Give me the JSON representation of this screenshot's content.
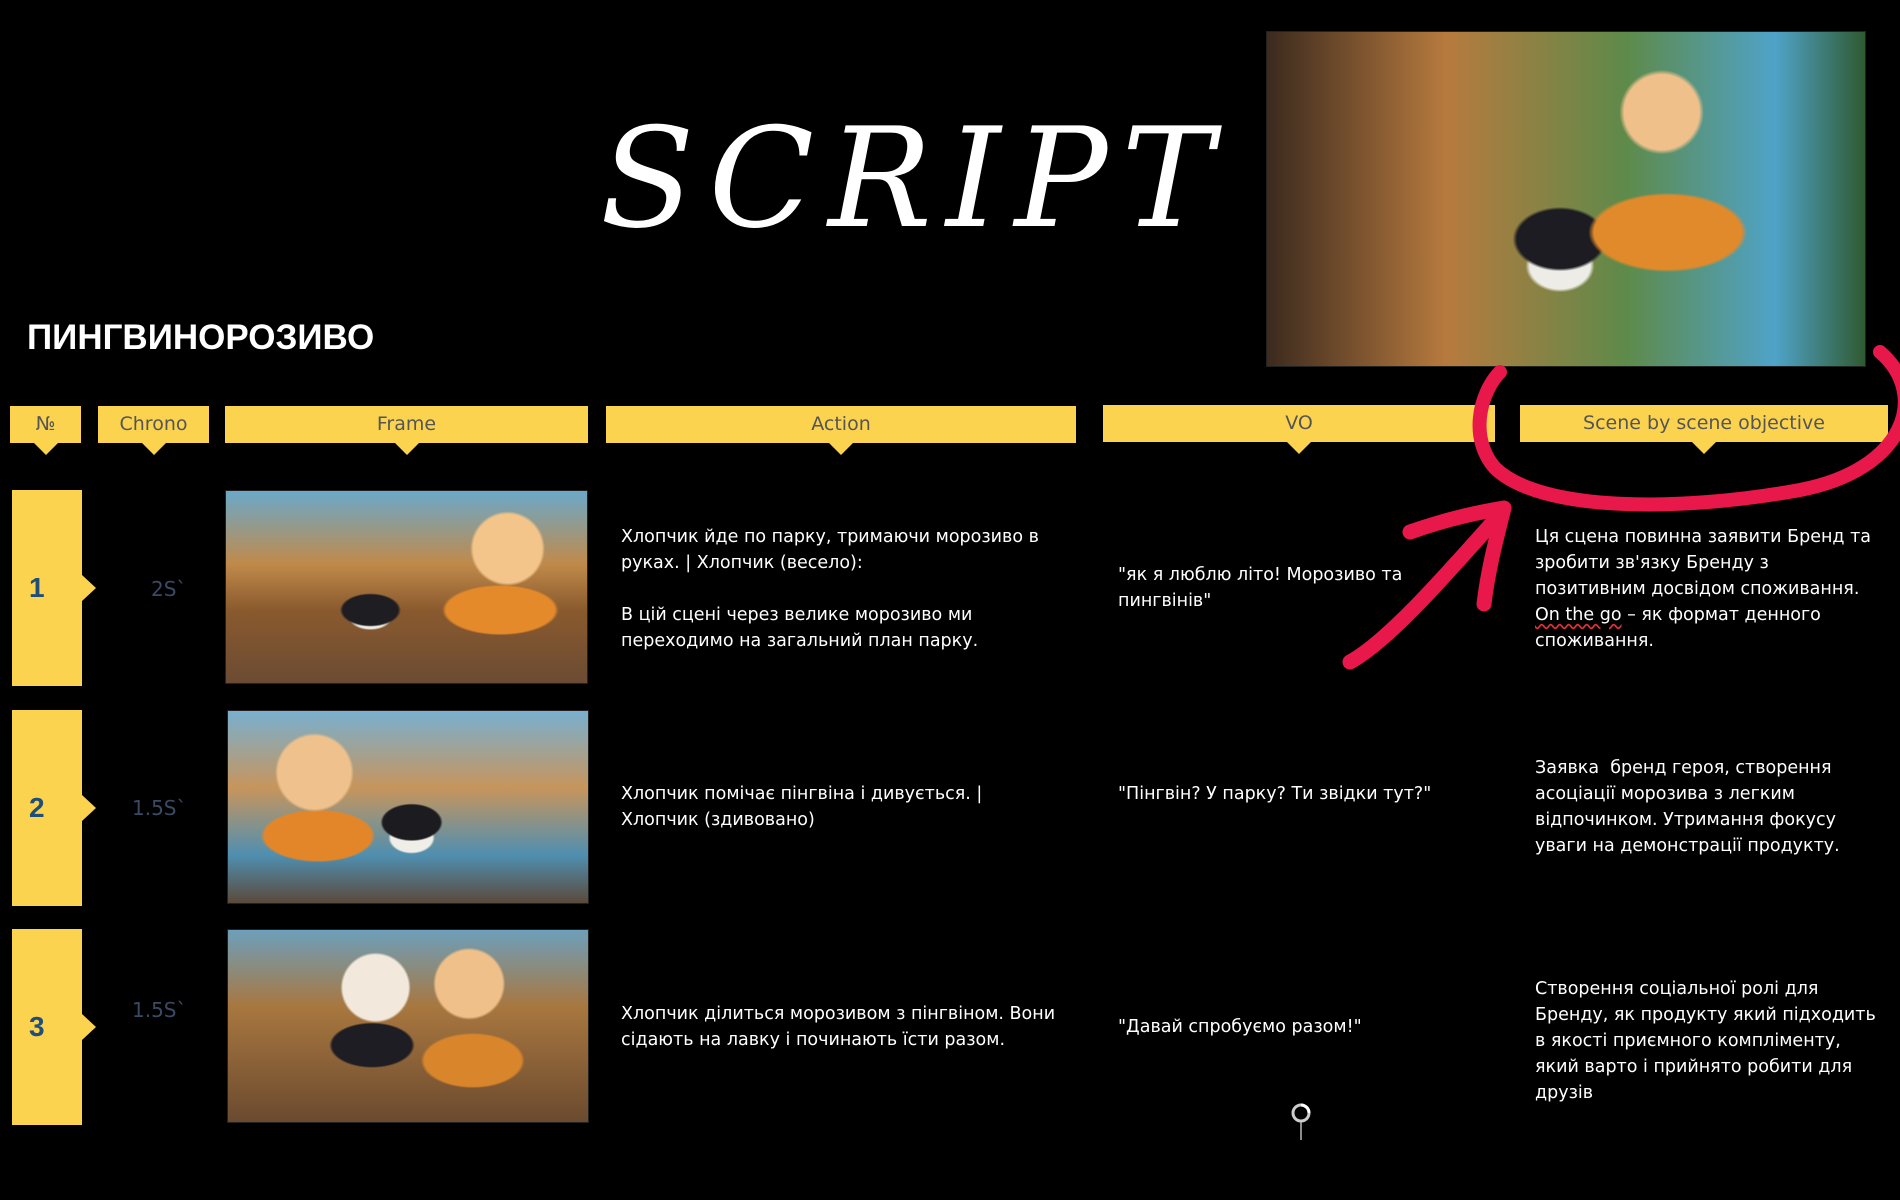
{
  "title": "SCRIPT",
  "brand": "ПИНГВИНОРОЗИВО",
  "headers": {
    "number": "№",
    "chrono": "Chrono",
    "frame": "Frame",
    "action": "Action",
    "vo": "VO",
    "objective": "Scene by scene objective"
  },
  "rows": [
    {
      "num": "1",
      "chrono": "2S`",
      "action": "Хлопчик йде по парку, тримаючи морозиво в руках. | Хлопчик (весело):\n\nВ цій сцені через велике морозиво ми переходимо на загальний план парку.",
      "vo": "\"як я люблю літо! Морозиво та пингвінів\"",
      "objective": "Ця сцена повинна заявити Бренд та зробити зв'язку Бренду з позитивним досвідом споживання.",
      "objective_link": "On the go",
      "objective_tail": " – як формат денного споживання."
    },
    {
      "num": "2",
      "chrono": "1.5S`",
      "action": "Хлопчик помічає пінгвіна і дивується. | Хлопчик (здивовано)",
      "vo": "\"Пінгвін? У парку? Ти звідки тут?\"",
      "objective": "Заявка  бренд героя, створення асоціації морозива з легким відпочинком. Утримання фокусу уваги на демонстрації продукту."
    },
    {
      "num": "3",
      "chrono": "1.5S`",
      "action": "Хлопчик ділиться морозивом з пінгвіном. Вони сідають на лавку і починають їсти разом.",
      "vo": "\"Давай спробуємо разом!\"",
      "objective": "Створення соціальної ролі для Бренду, як продукту який підходить в якості приємного компліменту, який варто і прийнято робити для друзів"
    }
  ],
  "colors": {
    "tab": "#fcd34f",
    "annotation": "#e8184a",
    "background": "#000000"
  }
}
